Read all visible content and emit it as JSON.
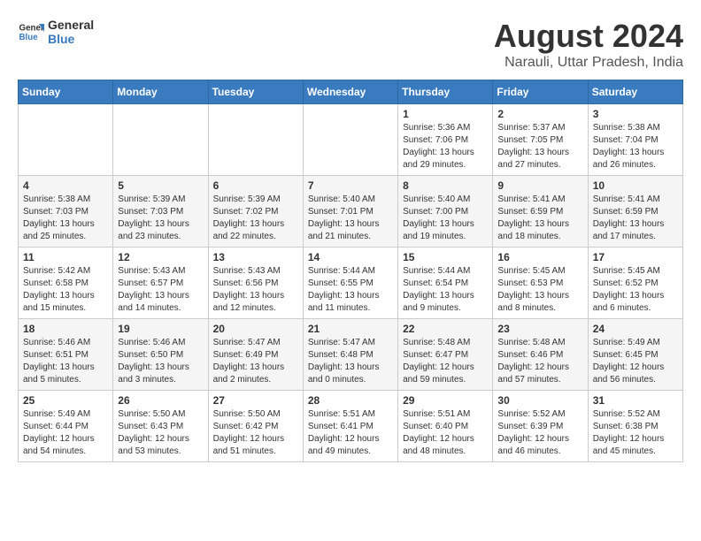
{
  "logo": {
    "line1": "General",
    "line2": "Blue"
  },
  "title": "August 2024",
  "subtitle": "Narauli, Uttar Pradesh, India",
  "days_of_week": [
    "Sunday",
    "Monday",
    "Tuesday",
    "Wednesday",
    "Thursday",
    "Friday",
    "Saturday"
  ],
  "weeks": [
    [
      {
        "day": "",
        "info": ""
      },
      {
        "day": "",
        "info": ""
      },
      {
        "day": "",
        "info": ""
      },
      {
        "day": "",
        "info": ""
      },
      {
        "day": "1",
        "info": "Sunrise: 5:36 AM\nSunset: 7:06 PM\nDaylight: 13 hours\nand 29 minutes."
      },
      {
        "day": "2",
        "info": "Sunrise: 5:37 AM\nSunset: 7:05 PM\nDaylight: 13 hours\nand 27 minutes."
      },
      {
        "day": "3",
        "info": "Sunrise: 5:38 AM\nSunset: 7:04 PM\nDaylight: 13 hours\nand 26 minutes."
      }
    ],
    [
      {
        "day": "4",
        "info": "Sunrise: 5:38 AM\nSunset: 7:03 PM\nDaylight: 13 hours\nand 25 minutes."
      },
      {
        "day": "5",
        "info": "Sunrise: 5:39 AM\nSunset: 7:03 PM\nDaylight: 13 hours\nand 23 minutes."
      },
      {
        "day": "6",
        "info": "Sunrise: 5:39 AM\nSunset: 7:02 PM\nDaylight: 13 hours\nand 22 minutes."
      },
      {
        "day": "7",
        "info": "Sunrise: 5:40 AM\nSunset: 7:01 PM\nDaylight: 13 hours\nand 21 minutes."
      },
      {
        "day": "8",
        "info": "Sunrise: 5:40 AM\nSunset: 7:00 PM\nDaylight: 13 hours\nand 19 minutes."
      },
      {
        "day": "9",
        "info": "Sunrise: 5:41 AM\nSunset: 6:59 PM\nDaylight: 13 hours\nand 18 minutes."
      },
      {
        "day": "10",
        "info": "Sunrise: 5:41 AM\nSunset: 6:59 PM\nDaylight: 13 hours\nand 17 minutes."
      }
    ],
    [
      {
        "day": "11",
        "info": "Sunrise: 5:42 AM\nSunset: 6:58 PM\nDaylight: 13 hours\nand 15 minutes."
      },
      {
        "day": "12",
        "info": "Sunrise: 5:43 AM\nSunset: 6:57 PM\nDaylight: 13 hours\nand 14 minutes."
      },
      {
        "day": "13",
        "info": "Sunrise: 5:43 AM\nSunset: 6:56 PM\nDaylight: 13 hours\nand 12 minutes."
      },
      {
        "day": "14",
        "info": "Sunrise: 5:44 AM\nSunset: 6:55 PM\nDaylight: 13 hours\nand 11 minutes."
      },
      {
        "day": "15",
        "info": "Sunrise: 5:44 AM\nSunset: 6:54 PM\nDaylight: 13 hours\nand 9 minutes."
      },
      {
        "day": "16",
        "info": "Sunrise: 5:45 AM\nSunset: 6:53 PM\nDaylight: 13 hours\nand 8 minutes."
      },
      {
        "day": "17",
        "info": "Sunrise: 5:45 AM\nSunset: 6:52 PM\nDaylight: 13 hours\nand 6 minutes."
      }
    ],
    [
      {
        "day": "18",
        "info": "Sunrise: 5:46 AM\nSunset: 6:51 PM\nDaylight: 13 hours\nand 5 minutes."
      },
      {
        "day": "19",
        "info": "Sunrise: 5:46 AM\nSunset: 6:50 PM\nDaylight: 13 hours\nand 3 minutes."
      },
      {
        "day": "20",
        "info": "Sunrise: 5:47 AM\nSunset: 6:49 PM\nDaylight: 13 hours\nand 2 minutes."
      },
      {
        "day": "21",
        "info": "Sunrise: 5:47 AM\nSunset: 6:48 PM\nDaylight: 13 hours\nand 0 minutes."
      },
      {
        "day": "22",
        "info": "Sunrise: 5:48 AM\nSunset: 6:47 PM\nDaylight: 12 hours\nand 59 minutes."
      },
      {
        "day": "23",
        "info": "Sunrise: 5:48 AM\nSunset: 6:46 PM\nDaylight: 12 hours\nand 57 minutes."
      },
      {
        "day": "24",
        "info": "Sunrise: 5:49 AM\nSunset: 6:45 PM\nDaylight: 12 hours\nand 56 minutes."
      }
    ],
    [
      {
        "day": "25",
        "info": "Sunrise: 5:49 AM\nSunset: 6:44 PM\nDaylight: 12 hours\nand 54 minutes."
      },
      {
        "day": "26",
        "info": "Sunrise: 5:50 AM\nSunset: 6:43 PM\nDaylight: 12 hours\nand 53 minutes."
      },
      {
        "day": "27",
        "info": "Sunrise: 5:50 AM\nSunset: 6:42 PM\nDaylight: 12 hours\nand 51 minutes."
      },
      {
        "day": "28",
        "info": "Sunrise: 5:51 AM\nSunset: 6:41 PM\nDaylight: 12 hours\nand 49 minutes."
      },
      {
        "day": "29",
        "info": "Sunrise: 5:51 AM\nSunset: 6:40 PM\nDaylight: 12 hours\nand 48 minutes."
      },
      {
        "day": "30",
        "info": "Sunrise: 5:52 AM\nSunset: 6:39 PM\nDaylight: 12 hours\nand 46 minutes."
      },
      {
        "day": "31",
        "info": "Sunrise: 5:52 AM\nSunset: 6:38 PM\nDaylight: 12 hours\nand 45 minutes."
      }
    ]
  ]
}
